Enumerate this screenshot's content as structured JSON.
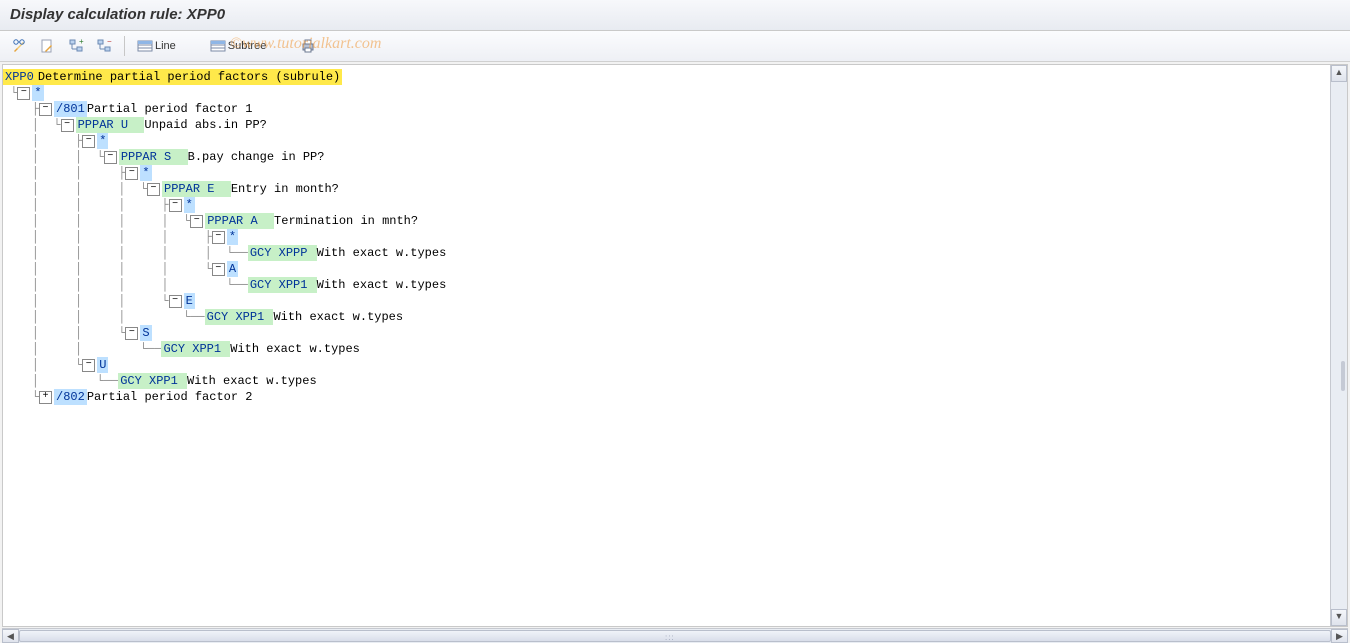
{
  "title": "Display calculation rule: XPP0",
  "watermark": "©www.tutorialkart.com",
  "toolbar": {
    "line_label": "Line",
    "subtree_label": "Subtree"
  },
  "tree": {
    "root_code": "XPP0",
    "root_desc": "Determine partial period factors (subrule)",
    "n1_code": "*",
    "n2_code": "/801",
    "n2_desc": "Partial period factor 1",
    "n3_code": "PPPAR U  ",
    "n3_desc": "Unpaid abs.in PP?",
    "n4_code": "*",
    "n5_code": "PPPAR S  ",
    "n5_desc": "B.pay change in PP?",
    "n6_code": "*",
    "n7_code": "PPPAR E  ",
    "n7_desc": "Entry in month?",
    "n8_code": "*",
    "n9_code": "PPPAR A  ",
    "n9_desc": "Termination in mnth?",
    "n10_code": "*",
    "n11_code": "GCY XPPP ",
    "n11_desc": "With exact w.types",
    "n12_code": "A",
    "n13_code": "GCY XPP1 ",
    "n13_desc": "With exact w.types",
    "n14_code": "E",
    "n15_code": "GCY XPP1 ",
    "n15_desc": "With exact w.types",
    "n16_code": "S",
    "n17_code": "GCY XPP1 ",
    "n17_desc": "With exact w.types",
    "n18_code": "U",
    "n19_code": "GCY XPP1 ",
    "n19_desc": "With exact w.types",
    "n20_code": "/802",
    "n20_desc": "Partial period factor 2"
  }
}
